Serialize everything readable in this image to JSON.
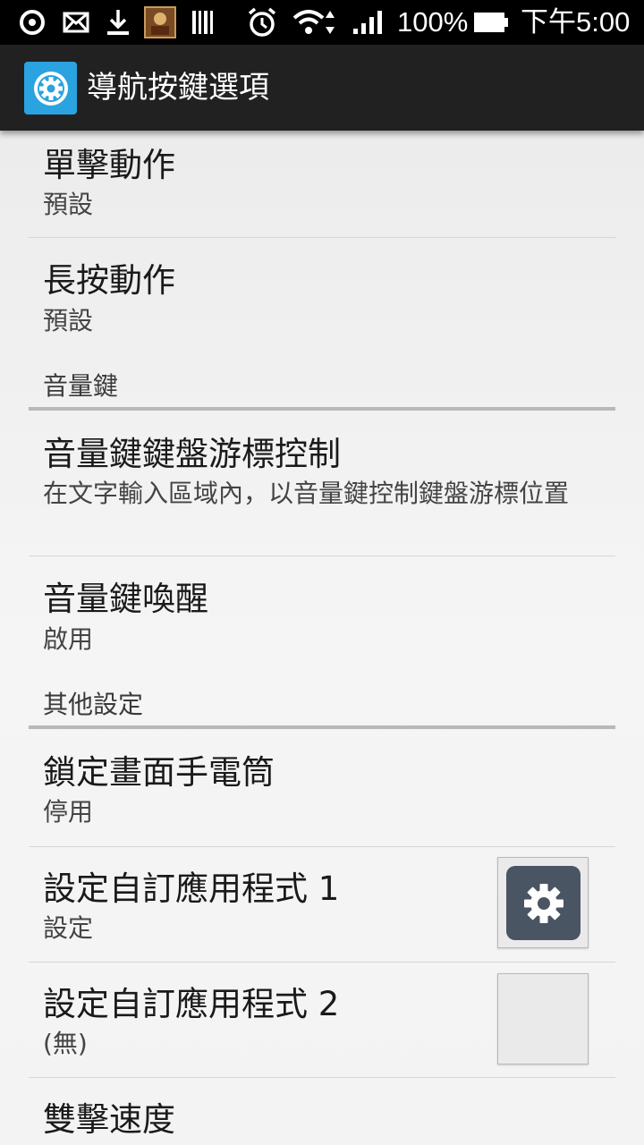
{
  "status_bar": {
    "battery": "100%",
    "time": "下午5:00"
  },
  "action_bar": {
    "title": "導航按鍵選項",
    "icon": "settings-gear-icon"
  },
  "colors": {
    "action_bar_bg": "#212121",
    "app_icon_bg": "#2aa3e0",
    "status_bar_bg": "#000000"
  },
  "preferences": {
    "single_tap": {
      "title": "單擊動作",
      "summary": "預設"
    },
    "long_press": {
      "title": "長按動作",
      "summary": "預設"
    },
    "category_volume": "音量鍵",
    "volume_cursor": {
      "title": "音量鍵鍵盤游標控制",
      "summary": "在文字輸入區域內，以音量鍵控制鍵盤游標位置"
    },
    "volume_wake": {
      "title": "音量鍵喚醒",
      "summary": "啟用"
    },
    "category_other": "其他設定",
    "lock_flashlight": {
      "title": "鎖定畫面手電筒",
      "summary": "停用"
    },
    "custom_app_1": {
      "title": "設定自訂應用程式 1",
      "summary": "設定",
      "widget_icon": "settings-gear-icon"
    },
    "custom_app_2": {
      "title": "設定自訂應用程式 2",
      "summary": "(無)"
    },
    "double_tap_speed": {
      "title": "雙擊速度"
    }
  }
}
